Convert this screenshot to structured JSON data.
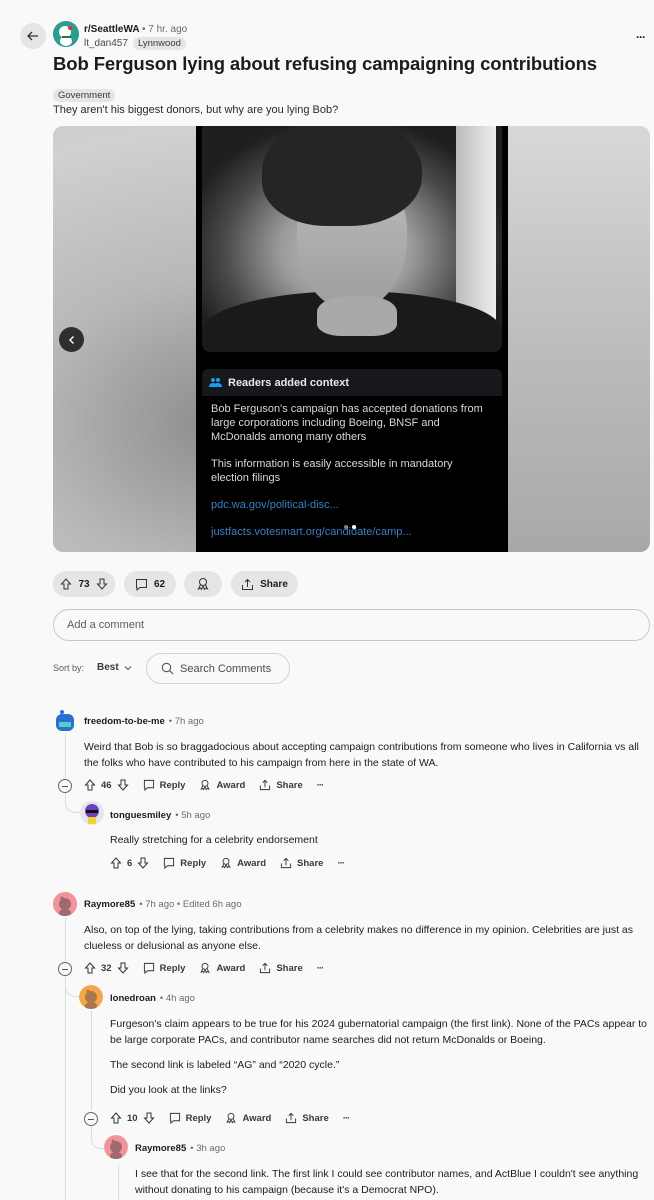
{
  "header": {
    "subreddit": "r/SeattleWA",
    "post_age": "7 hr. ago",
    "author": "lt_dan457",
    "author_flair": "Lynnwood",
    "more_label": "···"
  },
  "post": {
    "title": "Bob Ferguson lying about refusing campaigning contributions",
    "flair": "Government",
    "body": "They aren't his biggest donors, but why are you lying Bob?",
    "media": {
      "note_header": "Readers added context",
      "note_paragraphs": [
        "Bob Ferguson's campaign has accepted donations from large corporations including Boeing, BNSF and McDonalds among many others",
        "This information is easily accessible in mandatory election filings"
      ],
      "note_links": [
        "pdc.wa.gov/political-disc...",
        "justfacts.votesmart.org/candidate/camp..."
      ],
      "carousel_total": 2,
      "carousel_active": 2
    },
    "votes": "73",
    "comments": "62",
    "share_label": "Share"
  },
  "comment_box": {
    "placeholder": "Add a comment"
  },
  "sort": {
    "label": "Sort by:",
    "value": "Best"
  },
  "search": {
    "placeholder": "Search Comments"
  },
  "actions": {
    "reply": "Reply",
    "award": "Award",
    "share": "Share",
    "more": "···"
  },
  "comments": [
    {
      "user": "freedom-to-be-me",
      "meta": "• 7h ago",
      "paragraphs": [
        "Weird that Bob is so braggadocious about accepting campaign contributions from someone who lives in California vs all the folks who have contributed to his campaign from here in the state of WA."
      ],
      "votes": "46",
      "avatar_color": "#2c6fd1"
    },
    {
      "user": "tonguesmiley",
      "meta": "• 5h ago",
      "paragraphs": [
        "Really stretching for a celebrity endorsement"
      ],
      "votes": "6",
      "avatar_color": "#6a3fc4"
    },
    {
      "user": "Raymore85",
      "meta": "• 7h ago • Edited 6h ago",
      "paragraphs": [
        "Also, on top of the lying, taking contributions from a celebrity makes no difference in my opinion. Celebrities are just as clueless or delusional as anyone else."
      ],
      "votes": "32",
      "avatar_color": "#f0949a"
    },
    {
      "user": "lonedroan",
      "meta": "• 4h ago",
      "paragraphs": [
        "Furgeson's claim appears to be true for his 2024 gubernatorial campaign (the first link). None of the PACs appear to be large corporate PACs, and contributor name searches did not return McDonalds or Boeing.",
        "The second link is labeled “AG” and “2020 cycle.”",
        "Did you look at the links?"
      ],
      "votes": "10",
      "avatar_color": "#f4a64a"
    },
    {
      "user": "Raymore85",
      "meta": "• 3h ago",
      "paragraphs": [
        "I see that for the second link. The first link I could see contributor names, and ActBlue I couldn't see anything without donating to his campaign (because it's a Democrat NPO)."
      ],
      "votes": "",
      "avatar_color": "#f0949a"
    }
  ]
}
